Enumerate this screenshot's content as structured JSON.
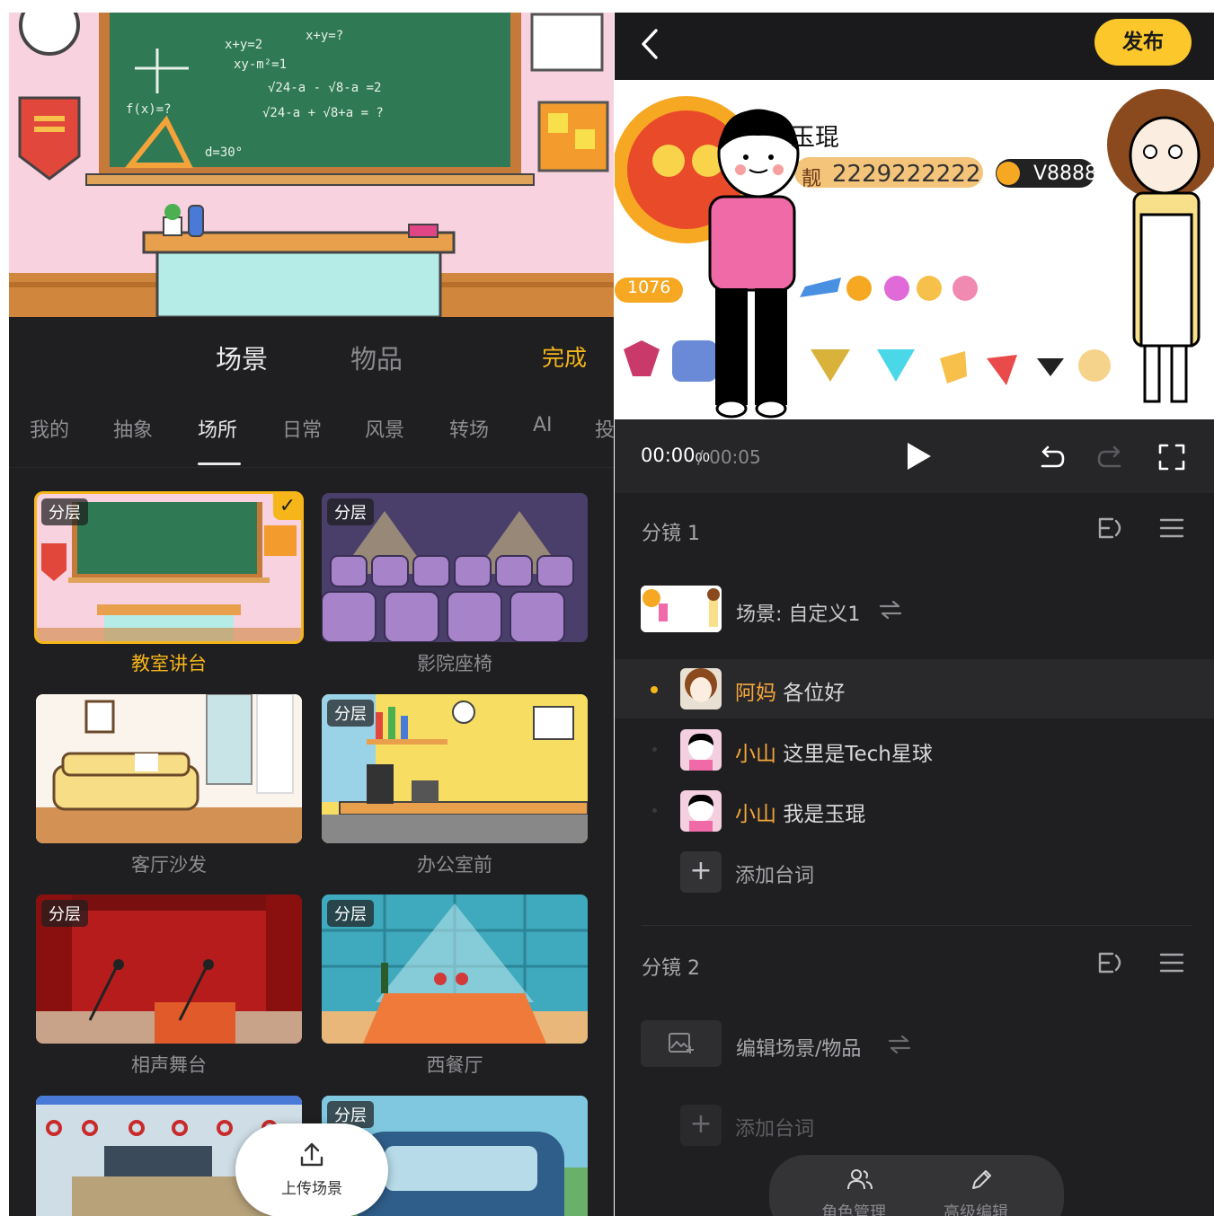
{
  "colors": {
    "accent": "#f6b61a",
    "publish": "#fbc72a",
    "speaker": "#f6a63a",
    "panel_bg": "#1f1f21"
  },
  "left": {
    "top_tabs": [
      {
        "label": "场景",
        "active": true
      },
      {
        "label": "物品",
        "active": false
      }
    ],
    "done_label": "完成",
    "categories": [
      "我的",
      "抽象",
      "场所",
      "日常",
      "风景",
      "转场",
      "AI",
      "投"
    ],
    "active_category": "场所",
    "scenes": [
      {
        "label": "教室讲台",
        "layered": true,
        "selected": true
      },
      {
        "label": "影院座椅",
        "layered": true,
        "selected": false
      },
      {
        "label": "客厅沙发",
        "layered": false,
        "selected": false
      },
      {
        "label": "办公室前",
        "layered": true,
        "selected": false
      },
      {
        "label": "相声舞台",
        "layered": true,
        "selected": false
      },
      {
        "label": "西餐厅",
        "layered": true,
        "selected": false
      },
      {
        "label": "",
        "layered": false,
        "selected": false
      },
      {
        "label": "",
        "layered": true,
        "selected": false
      }
    ],
    "layer_badge": "分层",
    "upload_label": "上传场景",
    "blackboard_text": [
      "x+y=2",
      "x+y=?",
      "xy-m²=1",
      "√24-a - √8-a =2",
      "√24-a + √8+a = ?",
      "f(x)=?",
      "d=30°"
    ]
  },
  "right": {
    "publish_label": "发布",
    "preview": {
      "name": "玉琨",
      "id_prefix": "靓",
      "id": "2229222222",
      "vip": "V8888",
      "level_number": "1076"
    },
    "time_current": "00:00",
    "time_current_frac": "00",
    "time_total": "/ 00:05",
    "shots": [
      {
        "title": "分镜 1",
        "scene_label": "场景: 自定义1",
        "lines": [
          {
            "speaker": "阿妈",
            "text": "各位好",
            "active": true
          },
          {
            "speaker": "小山",
            "text": "这里是Tech星球",
            "active": false
          },
          {
            "speaker": "小山",
            "text": "我是玉琨",
            "active": false
          }
        ],
        "add_line": "添加台词"
      },
      {
        "title": "分镜 2",
        "scene_label": "编辑场景/物品",
        "lines": [],
        "add_line": "添加台词"
      }
    ],
    "bottom": {
      "roles": "角色管理",
      "advanced": "高级编辑"
    }
  }
}
